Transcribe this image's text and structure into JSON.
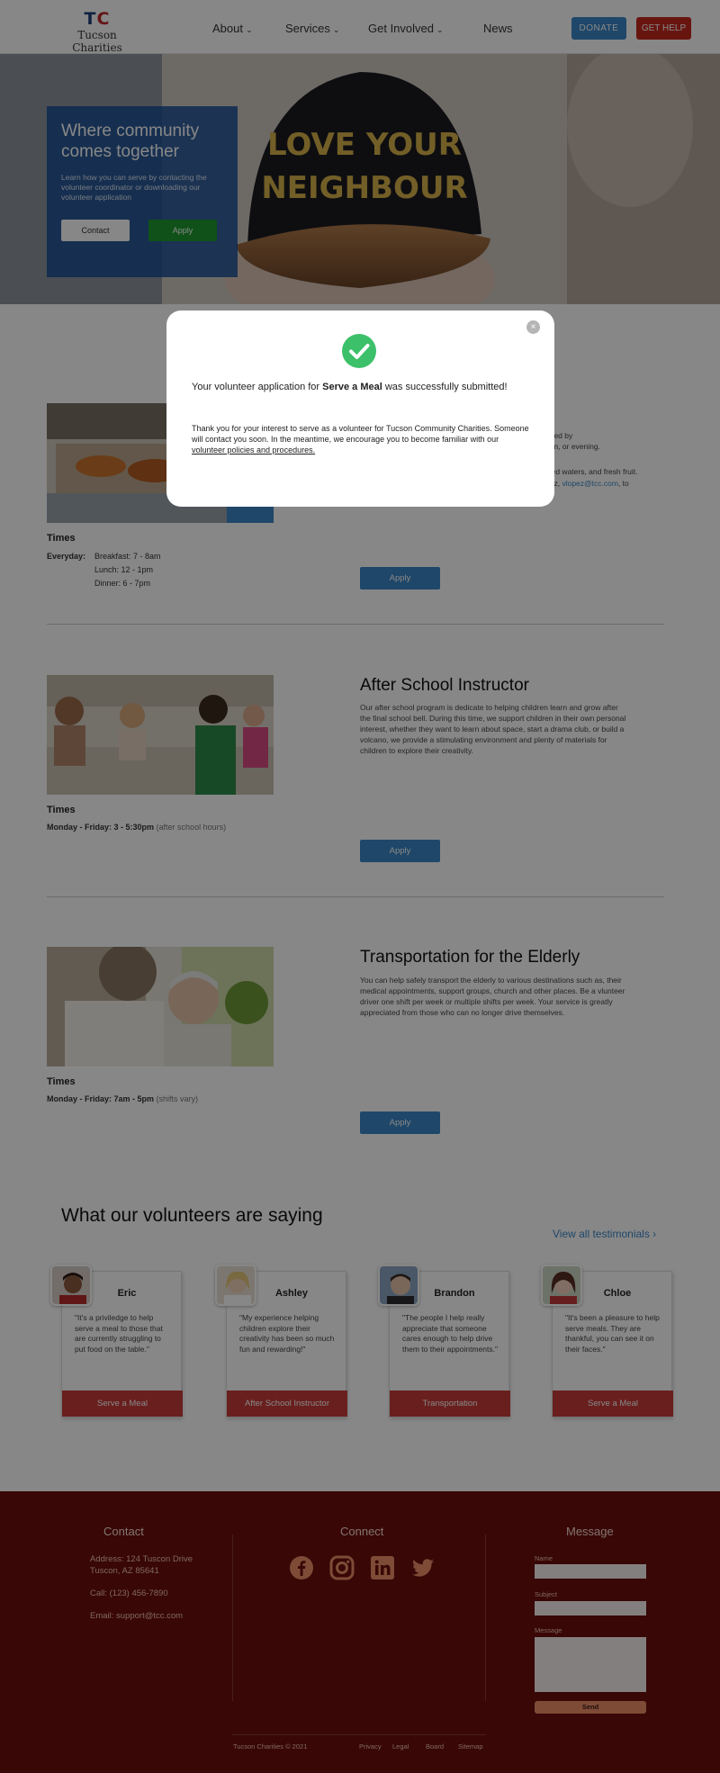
{
  "nav": {
    "logo_mark": "TC",
    "logo_name": "Tucson Charities",
    "items": [
      "About",
      "Services",
      "Get Involved",
      "News"
    ],
    "donate": "DONATE",
    "get_help": "GET HELP"
  },
  "hero": {
    "title": "Where community comes together",
    "subtitle": "Learn how you can serve by contacting the volunteer coordinator or downloading our volunteer application",
    "contact": "Contact",
    "apply": "Apply",
    "cap_text_line1": "LOVE YOUR",
    "cap_text_line2": "NEIGHBOUR"
  },
  "opportunities": [
    {
      "times_heading": "Times",
      "schedule_label": "Everyday:",
      "schedule": [
        "Breakfast: 7 - 8am",
        "Lunch: 12 - 1pm",
        "Dinner: 6 - 7pm"
      ],
      "partial_lines": [
        "need by",
        "oon, or evening.",
        "ttled waters, and fresh fruit.",
        "pez,",
        "vlopez@tcc.com",
        ", to"
      ],
      "apply": "Apply"
    },
    {
      "title": "After School Instructor",
      "description": "Our after school program is dedicate to helping children learn and grow after the final school bell. During this time, we support children in their own personal interest, whether they want to learn about space, start a drama club, or build a volcano, we provide a stimulating environment and plenty of materials for children to explore their creativity.",
      "times_heading": "Times",
      "times_bold": "Monday - Friday: 3 - 5:30pm",
      "times_note": "(after school hours)",
      "apply": "Apply"
    },
    {
      "title": "Transportation for the Elderly",
      "description": "You can help safely transport the elderly to various destinations such as, their medical appointments, support groups, church and other places. Be a vlunteer driver one shift per week or multiple shifts per week. Your service is greatly appreciated from those who can no longer drive themselves.",
      "times_heading": "Times",
      "times_bold": "Monday - Friday: 7am - 5pm",
      "times_note": "(shifts vary)",
      "apply": "Apply"
    }
  ],
  "testimonials": {
    "heading": "What our volunteers are saying",
    "view_all": "View all testimonials",
    "cards": [
      {
        "name": "Eric",
        "quote": "\"It's a priviledge to help serve a meal to those that are currently struggling to put food on the table.\"",
        "tag": "Serve a Meal"
      },
      {
        "name": "Ashley",
        "quote": "\"My experience helping children explore their creativity has been so much fun and rewarding!\"",
        "tag": "After School Instructor"
      },
      {
        "name": "Brandon",
        "quote": "\"The people I help really appreciate that someone cares enough to help drive them to their appointments.\"",
        "tag": "Transportation"
      },
      {
        "name": "Chloe",
        "quote": "\"It's been a pleasure to help serve meals. They are thankful, you can see it on their faces.\"",
        "tag": "Serve a Meal"
      }
    ]
  },
  "footer": {
    "contact_heading": "Contact",
    "address_line1": "Address: 124 Tuscon Drive",
    "address_line2": "Tuscon, AZ 85641",
    "call": "Call: (123) 456-7890",
    "email": "Email: support@tcc.com",
    "connect_heading": "Connect",
    "message_heading": "Message",
    "name_label": "Name",
    "subject_label": "Subject",
    "message_label": "Message",
    "send": "Send",
    "copyright": "Tucson Charities © 2021",
    "links": [
      "Privacy",
      "Legal",
      "Board",
      "Sitemap"
    ]
  },
  "modal": {
    "message_before": "Your volunteer application for ",
    "message_bold": "Serve a Meal",
    "message_after": " was successfully submitted!",
    "body_text": "Thank you for your interest to serve as a volunteer for Tucson Community Charities. Someone will contact you soon. In the meantime, we encourage you to become familiar with our ",
    "body_link": "volunteer policies and procedures.",
    "close_glyph": "×"
  },
  "colors": {
    "brand_blue": "#3b86c6",
    "brand_red": "#c5281f",
    "footer_bg": "#6b0f0c",
    "success_green": "#3cc06a"
  }
}
